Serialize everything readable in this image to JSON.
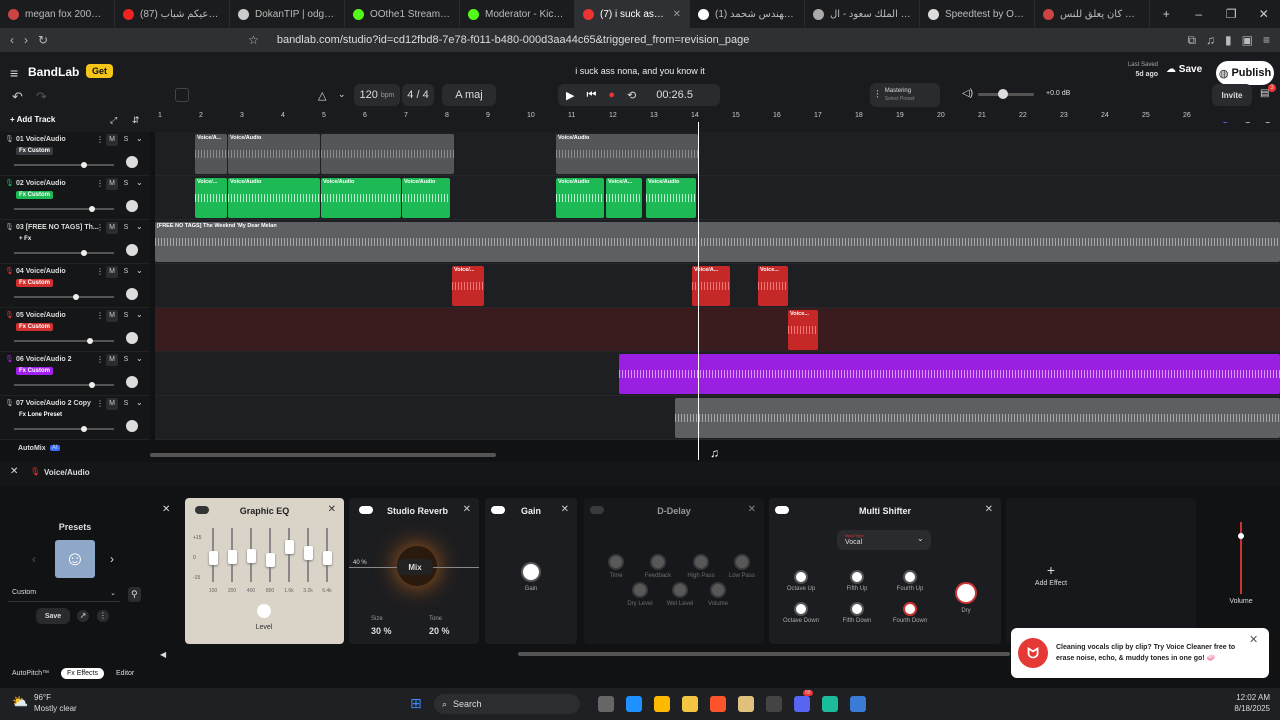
{
  "browser": {
    "tabs": [
      {
        "label": "megan fox 2007] - Bra",
        "color": "#c44"
      },
      {
        "label": "(87) ساعيكم شباب - ...",
        "color": "#e22"
      },
      {
        "label": "DokanTIP | odgotthat",
        "color": "#ccc"
      },
      {
        "label": "OOthe1 Stream - Wat",
        "color": "#53fc18"
      },
      {
        "label": "Moderator - Kick Dash",
        "color": "#53fc18"
      },
      {
        "label": "(7) i suck ass n",
        "color": "#e33",
        "active": true
      },
      {
        "label": "(1) باشمهندس شحمد X",
        "color": "#fff"
      },
      {
        "label": "جامعة الملك سعود - ال",
        "color": "#aaa"
      },
      {
        "label": "Speedtest by Ookla -",
        "color": "#ddd"
      },
      {
        "label": "المرحوم كان يعلق للنس",
        "color": "#c44"
      }
    ],
    "url": "bandlab.com/studio?id=cd12fbd8-7e78-f011-b480-000d3aa44c65&triggered_from=revision_page"
  },
  "header": {
    "logo": "BandLab",
    "get_label": "Get",
    "project_title": "i suck ass nona, and you know it",
    "last_saved_label": "Last Saved",
    "last_saved_value": "5d ago",
    "save_label": "Save",
    "publish_label": "Publish",
    "bpm": "120",
    "bpm_unit": "bpm",
    "time_sig": "4 / 4",
    "key": "A maj",
    "time": "00:26.5",
    "mastering_title": "Mastering",
    "mastering_sub": "Select Preset",
    "volume_db": "+0.0 dB",
    "invite_label": "Invite",
    "add_track_label": "Add Track",
    "notif_count": "3",
    "volume_level": 0.45
  },
  "timeline": [
    "1",
    "2",
    "3",
    "4",
    "5",
    "6",
    "7",
    "8",
    "9",
    "10",
    "11",
    "12",
    "13",
    "14",
    "15",
    "16",
    "17",
    "18",
    "19",
    "20",
    "21",
    "22",
    "23",
    "24",
    "25",
    "26"
  ],
  "tracks": [
    {
      "name": "01 Voice/Audio",
      "fx": "Fx Custom",
      "fx_color": "#3a3b40",
      "icon_color": "#aaa",
      "vol": 0.7
    },
    {
      "name": "02 Voice/Audio",
      "fx": "Fx Custom",
      "fx_color": "#1db954",
      "icon_color": "#1db954",
      "vol": 0.78
    },
    {
      "name": "03 [FREE NO TAGS] Th...",
      "fx": "+ Fx",
      "fx_color": "transparent",
      "icon_color": "#aaa",
      "vol": 0.7
    },
    {
      "name": "04 Voice/Audio",
      "fx": "Fx Custom",
      "fx_color": "#d32f2f",
      "icon_color": "#e33",
      "vol": 0.62
    },
    {
      "name": "05 Voice/Audio",
      "fx": "Fx Custom",
      "fx_color": "#d32f2f",
      "icon_color": "#e33",
      "vol": 0.76
    },
    {
      "name": "06 Voice/Audio 2",
      "fx": "Fx Custom",
      "fx_color": "#a020f0",
      "icon_color": "#a020f0",
      "vol": 0.78
    },
    {
      "name": "07 Voice/Audio 2 Copy",
      "fx": "Fx Lone Preset",
      "fx_color": "transparent",
      "icon_color": "#aaa",
      "vol": 0.7
    }
  ],
  "clips": {
    "lane0": [
      {
        "l": 40,
        "w": 32,
        "label": "Voice/A..."
      },
      {
        "l": 73,
        "w": 92,
        "label": "Voice/Audio"
      },
      {
        "l": 166,
        "w": 133,
        "label": ""
      },
      {
        "l": 401,
        "w": 142,
        "label": "Voice/Audio"
      }
    ],
    "lane1": [
      {
        "l": 40,
        "w": 32,
        "label": "Voice/..."
      },
      {
        "l": 73,
        "w": 92,
        "label": "Voice/Audio"
      },
      {
        "l": 166,
        "w": 80,
        "label": "Voice/Audio"
      },
      {
        "l": 247,
        "w": 48,
        "label": "Voice/Audio"
      },
      {
        "l": 401,
        "w": 48,
        "label": "Voice/Audio"
      },
      {
        "l": 451,
        "w": 36,
        "label": "Voice/A..."
      },
      {
        "l": 491,
        "w": 50,
        "label": "Voice/Audio"
      }
    ],
    "lane2": [
      {
        "l": 0,
        "w": 1125,
        "label": "[FREE NO TAGS] The Weeknd 'My Dear Melan"
      }
    ],
    "lane3": [
      {
        "l": 297,
        "w": 32,
        "label": "Voice/..."
      },
      {
        "l": 537,
        "w": 38,
        "label": "Voice/A..."
      },
      {
        "l": 603,
        "w": 30,
        "label": "Voice..."
      }
    ],
    "lane4": [
      {
        "l": 633,
        "w": 30,
        "label": "Voice..."
      }
    ],
    "lane5": [
      {
        "l": 464,
        "w": 661,
        "label": ""
      }
    ],
    "lane6": [
      {
        "l": 520,
        "w": 605,
        "label": ""
      }
    ]
  },
  "automix": {
    "label": "AutoMix",
    "badge": "AI"
  },
  "selected_track": "Voice/Audio",
  "presets": {
    "title": "Presets",
    "value": "Custom",
    "save_label": "Save"
  },
  "effects": {
    "eq": {
      "title": "Graphic EQ",
      "bands": [
        "100",
        "200",
        "400",
        "800",
        "1.6k",
        "3.2k",
        "6.4k"
      ],
      "scale": [
        "+15",
        "0",
        "-15"
      ],
      "level_label": "Level",
      "levels": [
        0.5,
        0.52,
        0.55,
        0.45,
        0.75,
        0.6,
        0.5
      ]
    },
    "reverb": {
      "title": "Studio Reverb",
      "mix_label": "Mix",
      "mix_pct": "40 %",
      "size_label": "Size",
      "size_value": "30 %",
      "tone_label": "Tone",
      "tone_value": "20 %"
    },
    "gain": {
      "title": "Gain",
      "knob_label": "Gain"
    },
    "delay": {
      "title": "D-Delay",
      "knobs": [
        "Time",
        "Feedback",
        "High Pass",
        "Low Pass",
        "Dry Level",
        "Wet Level",
        "Volume"
      ]
    },
    "shifter": {
      "title": "Multi Shifter",
      "input_label": "Input Type",
      "input_value": "Vocal",
      "knobs_top": [
        "Octave Up",
        "Fifth Up",
        "Fourth Up"
      ],
      "knobs_bottom": [
        "Octave Down",
        "Fifth Down",
        "Fourth Down"
      ],
      "dry_label": "Dry"
    },
    "add_label": "Add Effect",
    "volume_label": "Volume",
    "volume_level": 0.8
  },
  "bottom_tabs": [
    "AutoPitch™",
    "Fx Effects",
    "Editor"
  ],
  "toast": {
    "text": "Cleaning vocals clip by clip? Try Voice Cleaner free to erase noise, echo, & muddy tones in one go! 🧼"
  },
  "taskbar": {
    "temp": "96°F",
    "weather": "Mostly clear",
    "search": "Search",
    "time": "12:02 AM",
    "date": "8/18/2025",
    "chat_badge": "99"
  }
}
